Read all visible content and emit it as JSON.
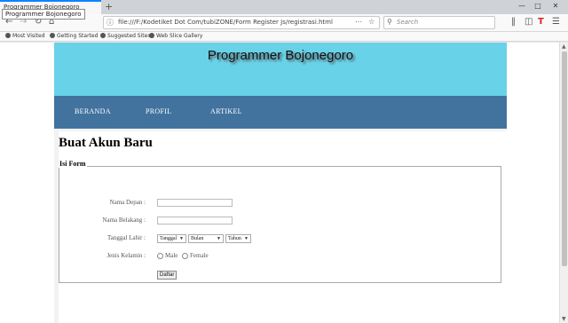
{
  "browser": {
    "tab_title": "Programmer Bojonegoro",
    "tooltip": "Programmer Bojonegoro",
    "new_tab": "+",
    "url": "file:///F:/Kodetiket Dot Com/tubiZONE/Form Register Js/registrasi.html",
    "search_placeholder": "Search",
    "bookmarks": [
      "Most Visited",
      "Getting Started",
      "Suggested Sites",
      "Web Slice Gallery"
    ]
  },
  "site": {
    "title": "Programmer Bojonegoro",
    "menu": [
      "BERANDA",
      "PROFIL",
      "ARTIKEL"
    ],
    "header_color": "#68d2e8",
    "menu_color": "#41739e"
  },
  "page": {
    "heading": "Buat Akun Baru",
    "legend": "Isi Form",
    "form": {
      "first_name_label": "Nama Depan :",
      "last_name_label": "Nama Belakang :",
      "dob_label": "Tanggal Lahir :",
      "day_select": "Tanggal",
      "month_select": "Bulan",
      "year_select": "Tahun",
      "gender_label": "Jenis Kelamin :",
      "male_label": "Male",
      "female_label": "Female",
      "submit_label": "Daftar"
    }
  }
}
